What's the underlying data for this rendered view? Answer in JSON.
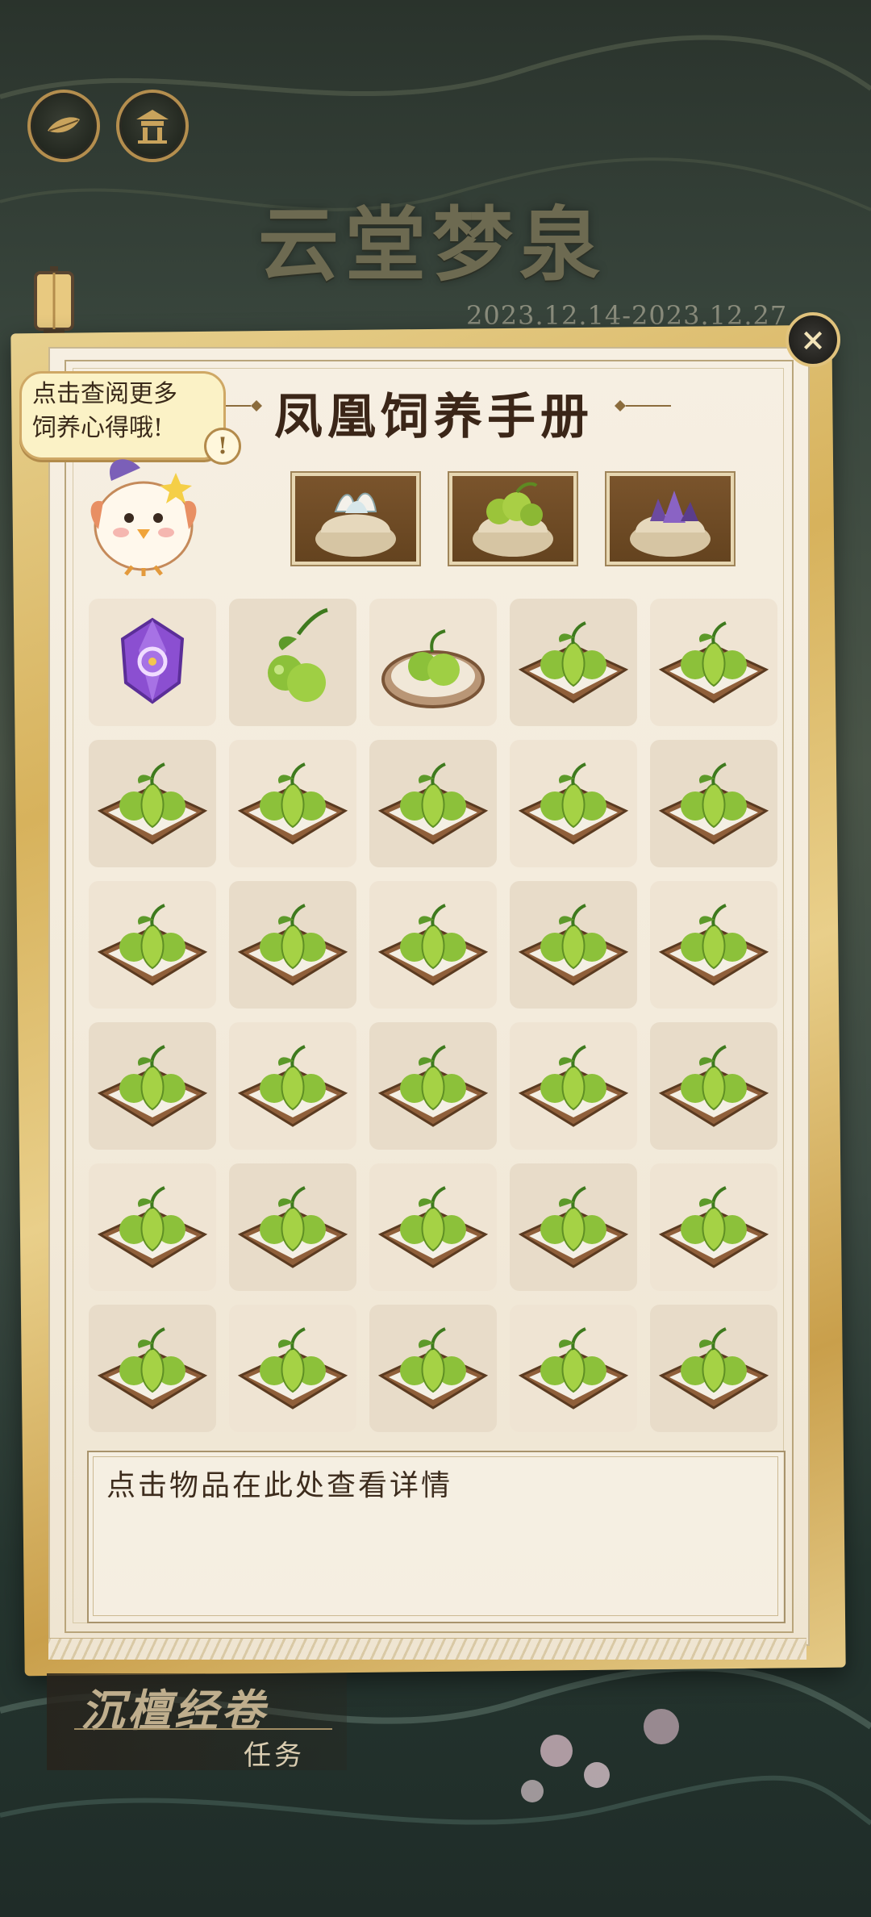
{
  "event": {
    "title": "云堂梦泉",
    "date_range": "2023.12.14-2023.12.27"
  },
  "top_buttons": [
    {
      "icon": "leaf-boat-icon"
    },
    {
      "icon": "pavilion-icon"
    }
  ],
  "handbook": {
    "title": "凤凰饲养手册",
    "close_icon": "close-icon",
    "close_label": "×",
    "hint_bubble": {
      "line1": "点击查阅更多",
      "line2": "饲养心得哦!"
    },
    "hint_badge": "!",
    "featured_items": [
      {
        "icon": "white-sprout-sack-icon"
      },
      {
        "icon": "green-fruit-sack-icon"
      },
      {
        "icon": "purple-crystal-sack-icon"
      }
    ],
    "grid": [
      "purple-crystal-icon",
      "green-seedling-icon",
      "seedling-plate-icon",
      "sprout-bed-icon",
      "sprout-bed-icon",
      "sprout-bed-icon",
      "sprout-bed-icon",
      "sprout-bed-icon",
      "sprout-bed-icon",
      "sprout-bed-icon",
      "sprout-bed-icon",
      "sprout-bed-icon",
      "sprout-bed-icon",
      "sprout-bed-icon",
      "sprout-bed-icon",
      "sprout-bed-icon",
      "sprout-bed-icon",
      "sprout-bed-icon",
      "sprout-bed-icon",
      "sprout-bed-icon",
      "sprout-bed-icon",
      "sprout-bed-icon",
      "sprout-bed-icon",
      "sprout-bed-icon",
      "sprout-bed-icon",
      "sprout-bed-icon",
      "sprout-bed-icon",
      "sprout-bed-icon",
      "sprout-bed-icon",
      "sprout-bed-icon"
    ],
    "detail_placeholder": "点击物品在此处查看详情"
  },
  "quest": {
    "title": "沉檀经卷",
    "label": "任务"
  },
  "colors": {
    "gold": "#d7b25c",
    "paper": "#f3ebdc",
    "ink": "#3b2618",
    "sprout_green": "#8fbf2e"
  }
}
